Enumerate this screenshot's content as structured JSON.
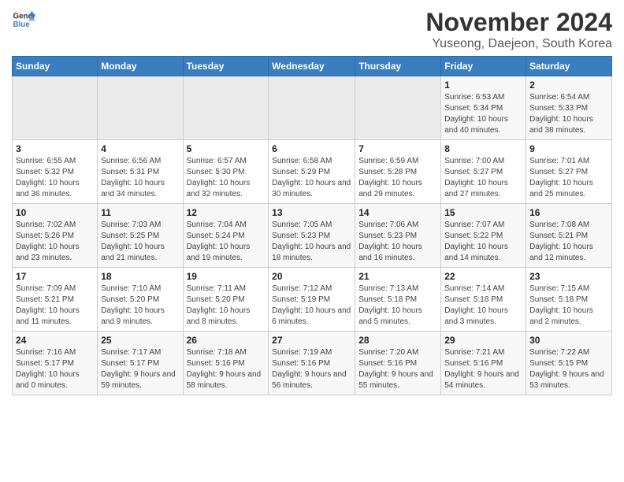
{
  "header": {
    "logo_line1": "General",
    "logo_line2": "Blue",
    "month_title": "November 2024",
    "location": "Yuseong, Daejeon, South Korea"
  },
  "weekdays": [
    "Sunday",
    "Monday",
    "Tuesday",
    "Wednesday",
    "Thursday",
    "Friday",
    "Saturday"
  ],
  "weeks": [
    [
      {
        "day": "",
        "info": ""
      },
      {
        "day": "",
        "info": ""
      },
      {
        "day": "",
        "info": ""
      },
      {
        "day": "",
        "info": ""
      },
      {
        "day": "",
        "info": ""
      },
      {
        "day": "1",
        "info": "Sunrise: 6:53 AM\nSunset: 5:34 PM\nDaylight: 10 hours and 40 minutes."
      },
      {
        "day": "2",
        "info": "Sunrise: 6:54 AM\nSunset: 5:33 PM\nDaylight: 10 hours and 38 minutes."
      }
    ],
    [
      {
        "day": "3",
        "info": "Sunrise: 6:55 AM\nSunset: 5:32 PM\nDaylight: 10 hours and 36 minutes."
      },
      {
        "day": "4",
        "info": "Sunrise: 6:56 AM\nSunset: 5:31 PM\nDaylight: 10 hours and 34 minutes."
      },
      {
        "day": "5",
        "info": "Sunrise: 6:57 AM\nSunset: 5:30 PM\nDaylight: 10 hours and 32 minutes."
      },
      {
        "day": "6",
        "info": "Sunrise: 6:58 AM\nSunset: 5:29 PM\nDaylight: 10 hours and 30 minutes."
      },
      {
        "day": "7",
        "info": "Sunrise: 6:59 AM\nSunset: 5:28 PM\nDaylight: 10 hours and 29 minutes."
      },
      {
        "day": "8",
        "info": "Sunrise: 7:00 AM\nSunset: 5:27 PM\nDaylight: 10 hours and 27 minutes."
      },
      {
        "day": "9",
        "info": "Sunrise: 7:01 AM\nSunset: 5:27 PM\nDaylight: 10 hours and 25 minutes."
      }
    ],
    [
      {
        "day": "10",
        "info": "Sunrise: 7:02 AM\nSunset: 5:26 PM\nDaylight: 10 hours and 23 minutes."
      },
      {
        "day": "11",
        "info": "Sunrise: 7:03 AM\nSunset: 5:25 PM\nDaylight: 10 hours and 21 minutes."
      },
      {
        "day": "12",
        "info": "Sunrise: 7:04 AM\nSunset: 5:24 PM\nDaylight: 10 hours and 19 minutes."
      },
      {
        "day": "13",
        "info": "Sunrise: 7:05 AM\nSunset: 5:23 PM\nDaylight: 10 hours and 18 minutes."
      },
      {
        "day": "14",
        "info": "Sunrise: 7:06 AM\nSunset: 5:23 PM\nDaylight: 10 hours and 16 minutes."
      },
      {
        "day": "15",
        "info": "Sunrise: 7:07 AM\nSunset: 5:22 PM\nDaylight: 10 hours and 14 minutes."
      },
      {
        "day": "16",
        "info": "Sunrise: 7:08 AM\nSunset: 5:21 PM\nDaylight: 10 hours and 12 minutes."
      }
    ],
    [
      {
        "day": "17",
        "info": "Sunrise: 7:09 AM\nSunset: 5:21 PM\nDaylight: 10 hours and 11 minutes."
      },
      {
        "day": "18",
        "info": "Sunrise: 7:10 AM\nSunset: 5:20 PM\nDaylight: 10 hours and 9 minutes."
      },
      {
        "day": "19",
        "info": "Sunrise: 7:11 AM\nSunset: 5:20 PM\nDaylight: 10 hours and 8 minutes."
      },
      {
        "day": "20",
        "info": "Sunrise: 7:12 AM\nSunset: 5:19 PM\nDaylight: 10 hours and 6 minutes."
      },
      {
        "day": "21",
        "info": "Sunrise: 7:13 AM\nSunset: 5:18 PM\nDaylight: 10 hours and 5 minutes."
      },
      {
        "day": "22",
        "info": "Sunrise: 7:14 AM\nSunset: 5:18 PM\nDaylight: 10 hours and 3 minutes."
      },
      {
        "day": "23",
        "info": "Sunrise: 7:15 AM\nSunset: 5:18 PM\nDaylight: 10 hours and 2 minutes."
      }
    ],
    [
      {
        "day": "24",
        "info": "Sunrise: 7:16 AM\nSunset: 5:17 PM\nDaylight: 10 hours and 0 minutes."
      },
      {
        "day": "25",
        "info": "Sunrise: 7:17 AM\nSunset: 5:17 PM\nDaylight: 9 hours and 59 minutes."
      },
      {
        "day": "26",
        "info": "Sunrise: 7:18 AM\nSunset: 5:16 PM\nDaylight: 9 hours and 58 minutes."
      },
      {
        "day": "27",
        "info": "Sunrise: 7:19 AM\nSunset: 5:16 PM\nDaylight: 9 hours and 56 minutes."
      },
      {
        "day": "28",
        "info": "Sunrise: 7:20 AM\nSunset: 5:16 PM\nDaylight: 9 hours and 55 minutes."
      },
      {
        "day": "29",
        "info": "Sunrise: 7:21 AM\nSunset: 5:16 PM\nDaylight: 9 hours and 54 minutes."
      },
      {
        "day": "30",
        "info": "Sunrise: 7:22 AM\nSunset: 5:15 PM\nDaylight: 9 hours and 53 minutes."
      }
    ]
  ]
}
